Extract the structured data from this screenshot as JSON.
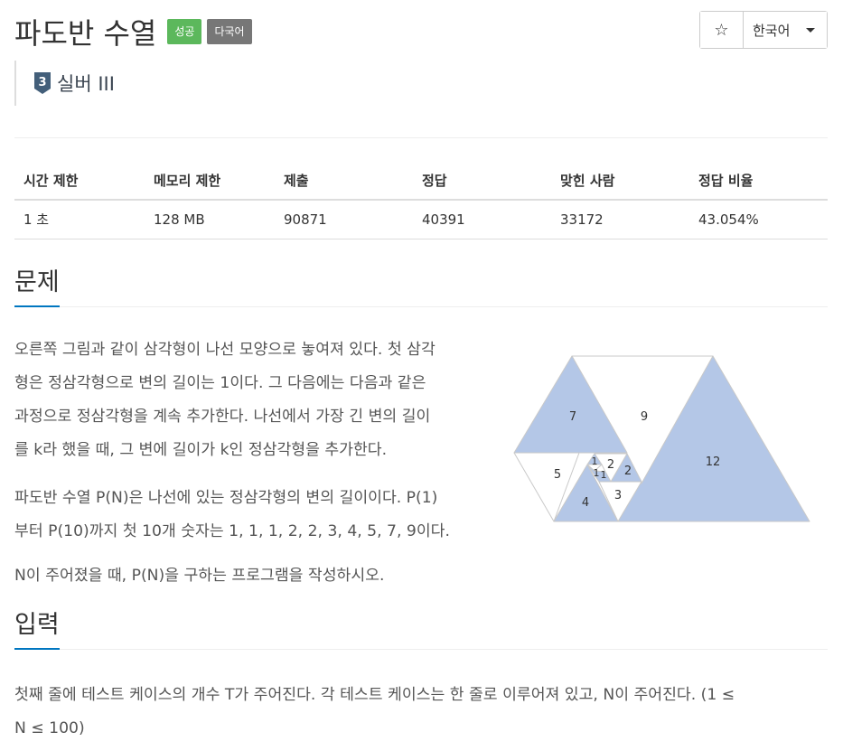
{
  "problem": {
    "title": "파도반 수열",
    "labels": [
      "성공",
      "다국어"
    ],
    "tier": "실버 III",
    "tier_number": "3"
  },
  "toolbar": {
    "star_icon": "☆",
    "language": "한국어"
  },
  "info_table": {
    "headers": [
      "시간 제한",
      "메모리 제한",
      "제출",
      "정답",
      "맞힌 사람",
      "정답 비율"
    ],
    "values": [
      "1 초",
      "128 MB",
      "90871",
      "40391",
      "33172",
      "43.054%"
    ]
  },
  "sections": {
    "problem": {
      "heading": "문제",
      "lines": [
        "오른쪽 그림과 같이 삼각형이 나선 모양으로 놓여져 있다. 첫 삼각",
        "형은 정삼각형으로 변의 길이는 1이다. 그 다음에는 다음과 같은",
        "과정으로 정삼각형을 계속 추가한다. 나선에서 가장 긴 변의 길이",
        "를 k라 했을 때, 그 변에 길이가 k인 정삼각형을 추가한다."
      ],
      "para2_lines": [
        "파도반 수열 P(N)은 나선에 있는 정삼각형의 변의 길이이다. P(1)",
        "부터 P(10)까지 첫 10개 숫자는 1, 1, 1, 2, 2, 3, 4, 5, 7, 9이다."
      ],
      "para3": "N이 주어졌을 때, P(N)을 구하는 프로그램을 작성하시오."
    },
    "input": {
      "heading": "입력",
      "lines": [
        "첫째 줄에 테스트 케이스의 개수 T가 주어진다. 각 테스트 케이스는 한 줄로 이루어져 있고, N이 주어진다. (1 ≤",
        "N ≤ 100)"
      ]
    }
  },
  "figure": {
    "triangle_labels": [
      "1",
      "1",
      "1",
      "2",
      "2",
      "3",
      "4",
      "5",
      "7",
      "9",
      "12"
    ]
  },
  "colors": {
    "success": "#5cb85c",
    "default": "#777777",
    "accent": "#0076c0",
    "triangle_fill": "#b4c7e7",
    "tier_silver": "#435f7a"
  }
}
